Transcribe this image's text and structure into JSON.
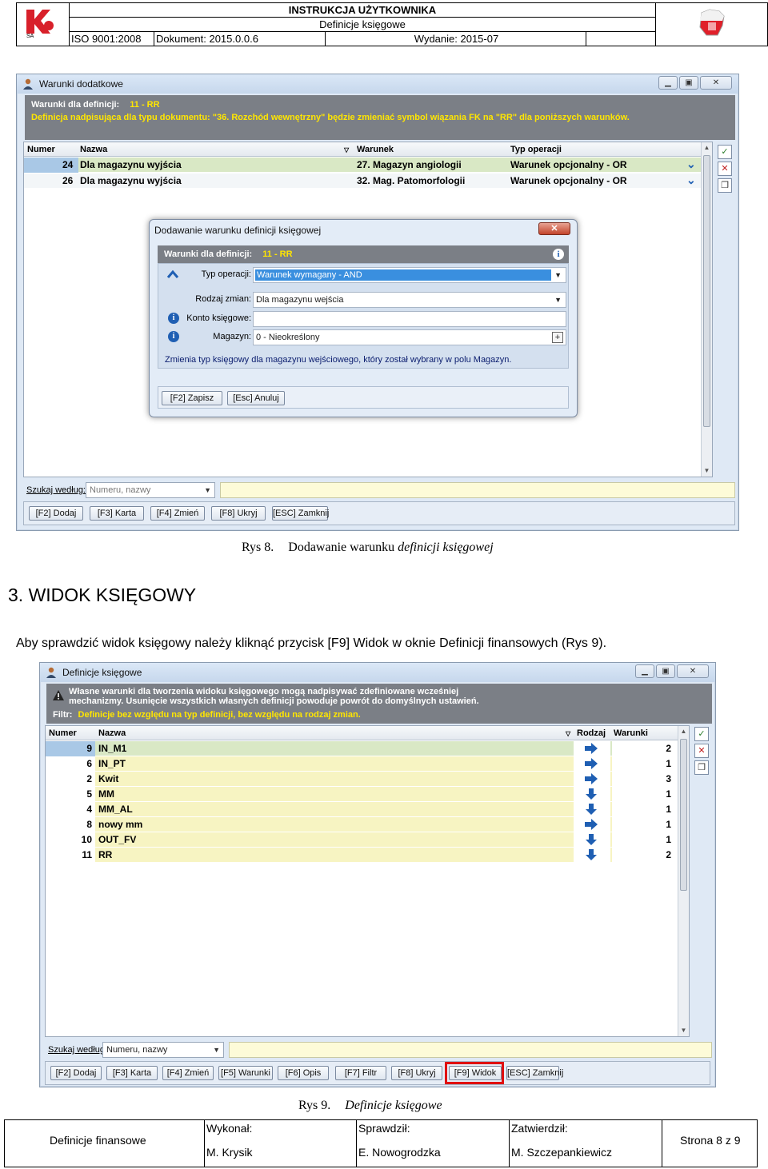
{
  "header": {
    "title": "INSTRUKCJA UŻYTKOWNIKA",
    "subtitle": "Definicje księgowe",
    "iso": "ISO 9001:2008",
    "document": "Dokument: 2015.0.0.6",
    "edition": "Wydanie: 2015-07",
    "logo_text": "SA"
  },
  "fig8": {
    "window_title": "Warunki dodatkowe",
    "banner_label": "Warunki dla definicji:",
    "banner_value": "11 - RR",
    "banner_line2": "Definicja nadpisująca dla typu dokumentu: \"36. Rozchód wewnętrzny\" będzie zmieniać symbol wiązania FK na \"RR\" dla poniższych warunków.",
    "columns": [
      "Numer",
      "Nazwa",
      "Warunek",
      "Typ operacji"
    ],
    "rows": [
      {
        "numer": "24",
        "nazwa": "Dla magazynu wyjścia",
        "warunek": "27. Magazyn angiologii",
        "typ": "Warunek opcjonalny - OR"
      },
      {
        "numer": "26",
        "nazwa": "Dla magazynu wyjścia",
        "warunek": "32. Mag. Patomorfologii",
        "typ": "Warunek opcjonalny - OR"
      }
    ],
    "search_label": "Szukaj według:",
    "search_placeholder": "Numeru, nazwy",
    "buttons": [
      "[F2] Dodaj",
      "[F3] Karta",
      "[F4] Zmień",
      "[F8] Ukryj",
      "[ESC] Zamknij"
    ],
    "dialog": {
      "title": "Dodawanie warunku definicji księgowej",
      "close": "✕",
      "banner_label": "Warunki dla definicji:",
      "banner_value": "11 - RR",
      "fields": [
        {
          "label": "Typ operacji:",
          "value": "Warunek wymagany - AND"
        },
        {
          "label": "Rodzaj zmian:",
          "value": "Dla magazynu wejścia"
        },
        {
          "label": "Konto księgowe:",
          "value": ""
        },
        {
          "label": "Magazyn:",
          "value": "0 - Nieokreślony"
        }
      ],
      "description": "Zmienia typ księgowy dla magazynu wejściowego, który został wybrany w polu Magazyn.",
      "buttons": [
        "[F2] Zapisz",
        "[Esc] Anuluj"
      ]
    },
    "caption_prefix": "Rys 8.",
    "caption_text": "Dodawanie warunku",
    "caption_italic": "definicji księgowej"
  },
  "section": {
    "heading": "3.  WIDOK KSIĘGOWY",
    "paragraph": "Aby sprawdzić widok księgowy należy kliknąć przycisk [F9] Widok w oknie Definicji finansowych (Rys 9)."
  },
  "fig9": {
    "window_title": "Definicje księgowe",
    "warning_line1": "Własne warunki dla tworzenia widoku księgowego mogą nadpisywać zdefiniowane wcześniej",
    "warning_line2": "mechanizmy. Usunięcie wszystkich własnych definicji powoduje powrót do domyślnych ustawień.",
    "filter_label": "Filtr:",
    "filter_value": "Definicje bez względu na typ definicji, bez względu na rodzaj zmian.",
    "columns": [
      "Numer",
      "Nazwa",
      "Rodzaj",
      "Warunki"
    ],
    "rows": [
      {
        "numer": "9",
        "nazwa": "IN_M1",
        "rodzaj": "right",
        "warunki": "2"
      },
      {
        "numer": "6",
        "nazwa": "IN_PT",
        "rodzaj": "right",
        "warunki": "1"
      },
      {
        "numer": "2",
        "nazwa": "Kwit",
        "rodzaj": "right",
        "warunki": "3"
      },
      {
        "numer": "5",
        "nazwa": "MM",
        "rodzaj": "down",
        "warunki": "1"
      },
      {
        "numer": "4",
        "nazwa": "MM_AL",
        "rodzaj": "down",
        "warunki": "1"
      },
      {
        "numer": "8",
        "nazwa": "nowy mm",
        "rodzaj": "right",
        "warunki": "1"
      },
      {
        "numer": "10",
        "nazwa": "OUT_FV",
        "rodzaj": "down",
        "warunki": "1"
      },
      {
        "numer": "11",
        "nazwa": "RR",
        "rodzaj": "down",
        "warunki": "2"
      }
    ],
    "search_label": "Szukaj według:",
    "search_placeholder": "Numeru, nazwy",
    "buttons": [
      "[F2] Dodaj",
      "[F3] Karta",
      "[F4] Zmień",
      "[F5] Warunki",
      "[F6] Opis",
      "[F7] Filtr",
      "[F8] Ukryj",
      "[F9] Widok",
      "[ESC] Zamknij"
    ],
    "caption_prefix": "Rys 9.",
    "caption_italic": "Definicje księgowe"
  },
  "footer": {
    "cell1": "Definicje finansowe",
    "made_label": "Wykonał:",
    "made_value": "M. Krysik",
    "checked_label": "Sprawdził:",
    "checked_value": "E. Nowogrodzka",
    "approved_label": "Zatwierdził:",
    "approved_value": "M. Szczepankiewicz",
    "page": "Strona 8 z 9"
  },
  "colors": {
    "banner_bg": "#7b7f86",
    "highlight_yellow": "#ffe600",
    "row_selected": "#a9c8e6",
    "row_green": "#d9e8c5",
    "row_yellow": "#f7f4c2",
    "arrow_blue": "#1f5fb3",
    "red_frame": "#e01010"
  }
}
